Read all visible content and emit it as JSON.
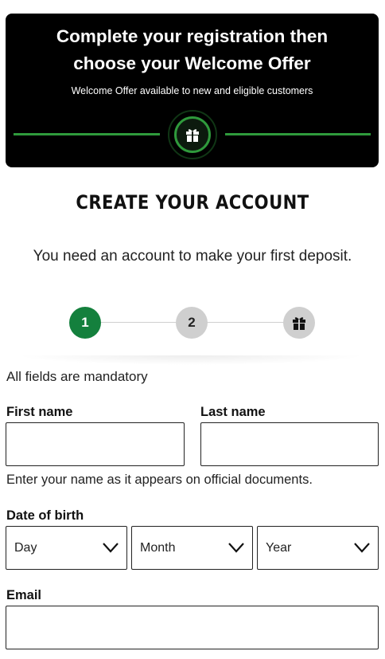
{
  "banner": {
    "title_line1": "Complete your registration then",
    "title_line2": "choose your Welcome Offer",
    "subtitle": "Welcome Offer available to new and eligible customers",
    "icon": "gift-icon"
  },
  "header": {
    "title": "CREATE YOUR ACCOUNT",
    "intro": "You need an account to make your first deposit."
  },
  "stepper": {
    "steps": [
      {
        "label": "1",
        "state": "active"
      },
      {
        "label": "2",
        "state": "inactive"
      },
      {
        "icon": "gift-icon",
        "state": "inactive"
      }
    ]
  },
  "form": {
    "mandatory_note": "All fields are mandatory",
    "first_name": {
      "label": "First name",
      "value": ""
    },
    "last_name": {
      "label": "Last name",
      "value": ""
    },
    "name_helper": "Enter your name as it appears on official documents.",
    "dob": {
      "label": "Date of birth",
      "day": "Day",
      "month": "Month",
      "year": "Year"
    },
    "email": {
      "label": "Email",
      "value": ""
    }
  },
  "colors": {
    "accent_green": "#14803d",
    "banner_line_green": "#2f9a3c",
    "banner_bg": "#000000",
    "inactive_step": "#cfcfcf"
  }
}
